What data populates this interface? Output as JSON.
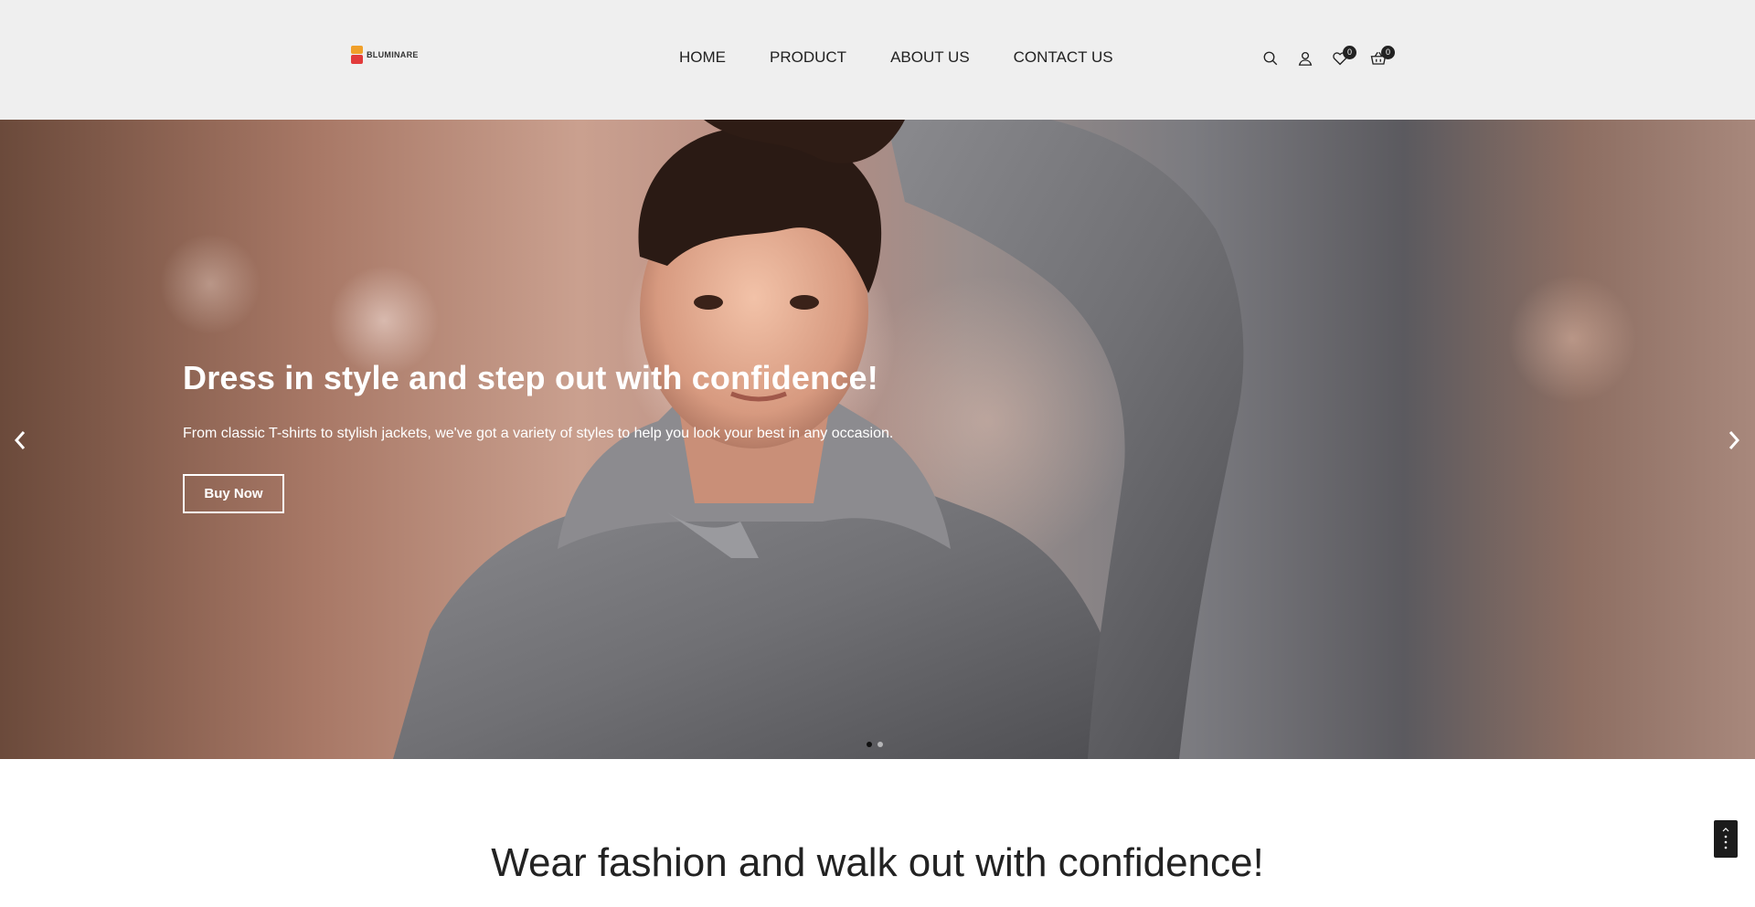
{
  "brand": {
    "name": "BLUMINARE"
  },
  "nav": {
    "items": [
      "HOME",
      "PRODUCT",
      "ABOUT US",
      "CONTACT US"
    ]
  },
  "header_icons": {
    "search": "search-icon",
    "account": "user-icon",
    "wishlist": {
      "icon": "heart-icon",
      "count": "0"
    },
    "cart": {
      "icon": "basket-icon",
      "count": "0"
    }
  },
  "hero": {
    "title": "Dress in style and step out with confidence!",
    "subtitle": "From classic T-shirts to stylish jackets, we've got a variety of styles to help you look your best in any occasion.",
    "cta_label": "Buy Now",
    "slide_count": 2,
    "active_slide": 1
  },
  "section": {
    "heading": "Wear fashion and walk out with confidence!"
  },
  "colors": {
    "header_bg": "#efefef",
    "text_dark": "#222222",
    "badge_bg": "#222222",
    "logo_orange": "#f0a02a",
    "logo_red": "#e23b3b"
  }
}
